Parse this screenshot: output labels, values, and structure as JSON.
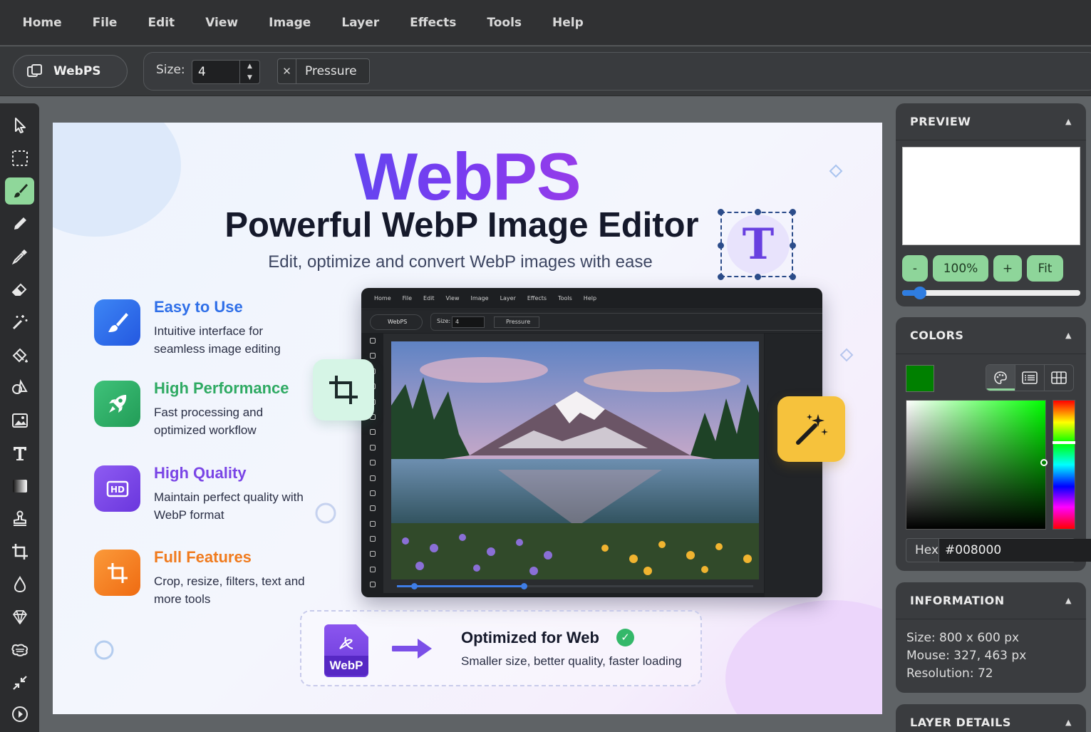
{
  "menu": [
    "Home",
    "File",
    "Edit",
    "View",
    "Image",
    "Layer",
    "Effects",
    "Tools",
    "Help"
  ],
  "app": {
    "name": "WebPS"
  },
  "options": {
    "size_label": "Size:",
    "size_value": "4",
    "pressure_label": "Pressure"
  },
  "tools": [
    "pointer-icon",
    "marquee-icon",
    "brush-icon",
    "pencil-icon",
    "eyedropper-icon",
    "eraser-icon",
    "magic-wand-icon",
    "fill-icon",
    "shapes-icon",
    "image-icon",
    "text-icon",
    "gradient-icon",
    "stamp-icon",
    "crop-icon",
    "blur-icon",
    "sharpen-icon",
    "smudge-icon",
    "resize-icon",
    "play-icon"
  ],
  "active_tool": "brush-icon",
  "canvas": {
    "title": "WebPS",
    "subtitle": "Powerful WebP Image Editor",
    "tagline": "Edit, optimize and convert WebP images with ease",
    "text_badge": "T",
    "features": [
      {
        "title": "Easy to Use",
        "desc": "Intuitive interface for seamless image editing",
        "color": "#2f6fe8",
        "icon": "brush-icon"
      },
      {
        "title": "High Performance",
        "desc": "Fast processing and optimized workflow",
        "color": "#2faa63",
        "icon": "rocket-icon"
      },
      {
        "title": "High Quality",
        "desc": "Maintain perfect quality with WebP format",
        "color": "#7a45e6",
        "icon": "hd-icon"
      },
      {
        "title": "Full Features",
        "desc": "Crop, resize, filters, text and more tools",
        "color": "#f07b1e",
        "icon": "crop-icon"
      }
    ],
    "mockup": {
      "menu": [
        "Home",
        "File",
        "Edit",
        "View",
        "Image",
        "Layer",
        "Effects",
        "Tools",
        "Help"
      ],
      "app_name": "WebPS",
      "size_label": "Size:",
      "size_value": "4",
      "pressure_label": "Pressure"
    },
    "web_box": {
      "file_label": "WebP",
      "title": "Optimized for Web",
      "subtitle": "Smaller size, better quality, faster loading"
    }
  },
  "panels": {
    "preview": {
      "title": "PREVIEW",
      "zoom_out": "-",
      "zoom_level": "100%",
      "zoom_in": "+",
      "fit": "Fit",
      "zoom_slider": 0.1
    },
    "colors": {
      "title": "COLORS",
      "current_color": "#008000",
      "hex_label": "Hex",
      "hex_value": "#008000"
    },
    "information": {
      "title": "INFORMATION",
      "size": "Size: 800 x 600 px",
      "mouse": "Mouse: 327, 463 px",
      "resolution": "Resolution: 72"
    },
    "layer_details": {
      "title": "LAYER DETAILS"
    }
  }
}
